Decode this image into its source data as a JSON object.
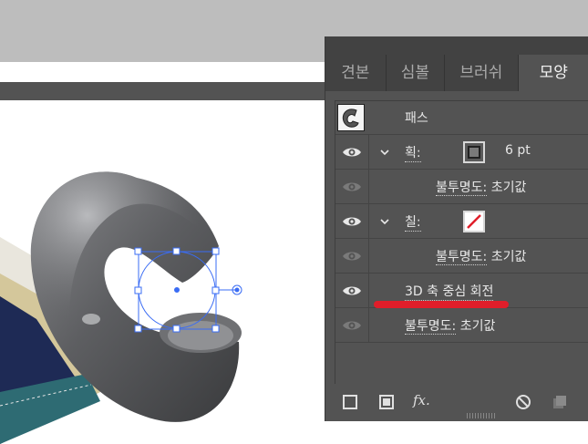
{
  "panel": {
    "tabs": [
      {
        "label": "견본"
      },
      {
        "label": "심볼"
      },
      {
        "label": "브러쉬"
      },
      {
        "label": "모양"
      }
    ],
    "active_tab": "모양",
    "object_label": "패스",
    "stroke": {
      "label": "획:",
      "value": "6 pt",
      "opacity_label": "불투명도:",
      "opacity_value": "초기값"
    },
    "fill": {
      "label": "칠:",
      "opacity_label": "불투명도:",
      "opacity_value": "초기값"
    },
    "effect": {
      "label": "3D 축 중심 회전"
    },
    "object_opacity": {
      "label": "불투명도:",
      "value": "초기값"
    },
    "footer_icons": [
      "add-stroke-icon",
      "add-fill-icon",
      "fx-icon",
      "clear-appearance-icon",
      "duplicate-icon"
    ],
    "fx_label": "fx."
  },
  "colors": {
    "accent_mark": "#e01e2a",
    "panel_bg": "#535353",
    "selection": "#3a6cf4"
  }
}
